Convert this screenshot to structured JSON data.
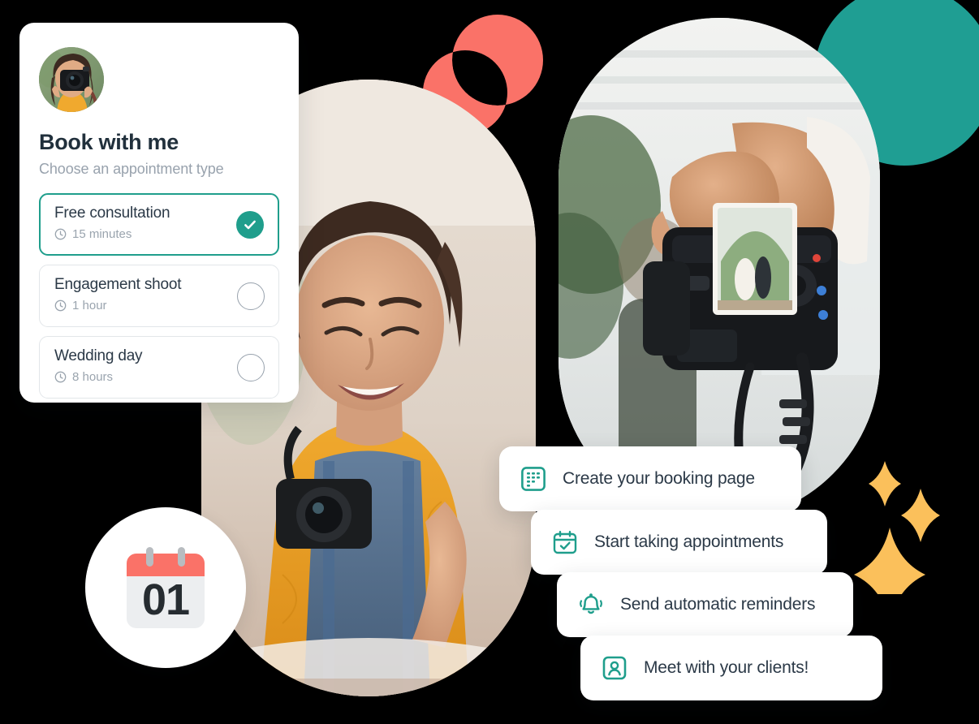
{
  "booking_card": {
    "avatar_alt": "photographer-avatar",
    "title": "Book with me",
    "subtitle": "Choose an appointment type",
    "appointments": [
      {
        "name": "Free consultation",
        "duration": "15 minutes",
        "selected": true,
        "mark": "check-filled"
      },
      {
        "name": "Engagement shoot",
        "duration": "1 hour",
        "selected": false,
        "mark": "radio-empty"
      },
      {
        "name": "Wedding day",
        "duration": "8 hours",
        "selected": false,
        "mark": "radio-empty"
      }
    ]
  },
  "calendar_badge": {
    "day_number": "01",
    "icon": "calendar-emoji"
  },
  "feature_pills": [
    {
      "label": "Create your booking page",
      "icon": "booking-page-icon"
    },
    {
      "label": "Start taking appointments",
      "icon": "calendar-check-icon"
    },
    {
      "label": "Send automatic reminders",
      "icon": "bell-icon"
    },
    {
      "label": "Meet with your clients!",
      "icon": "person-card-icon"
    }
  ],
  "photos": [
    {
      "name": "woman-photographer-laptop",
      "shape": "oval"
    },
    {
      "name": "hands-holding-camera",
      "shape": "oval"
    }
  ],
  "decor": {
    "coral_circles": "two-overlapping-circles",
    "teal_circle": "teal-circle",
    "sparkles": "three-star-sparkles"
  },
  "colors": {
    "teal": "#1f9e8c",
    "teal_deep": "#1f9e93",
    "coral": "#fa7268",
    "amber": "#fbc05b",
    "text_dark": "#2b3947",
    "text_muted": "#98a2ad",
    "background": "#000000",
    "card_white": "#ffffff"
  }
}
